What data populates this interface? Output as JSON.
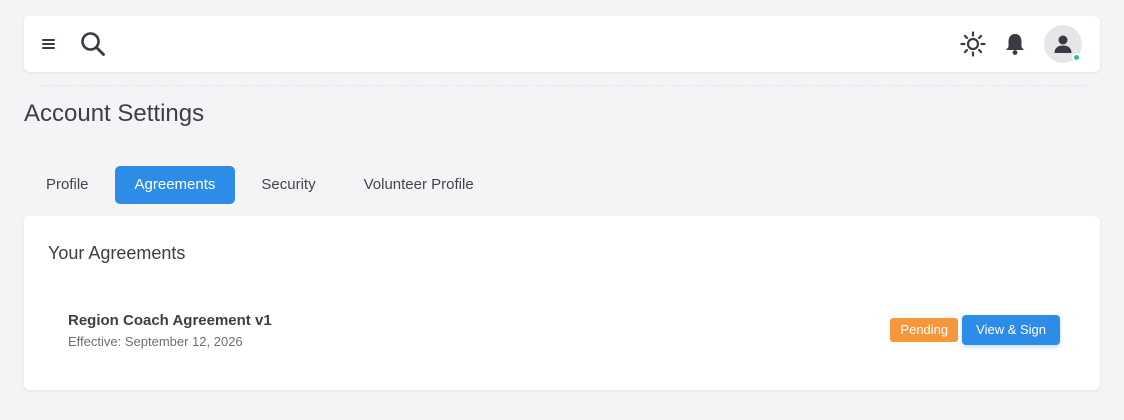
{
  "header": {
    "icons": [
      "menu-icon",
      "search-icon",
      "sun-icon",
      "bell-icon",
      "user-icon"
    ],
    "online_status_color": "#28c76f"
  },
  "page": {
    "title": "Account Settings"
  },
  "tabs": [
    {
      "label": "Profile",
      "active": false
    },
    {
      "label": "Agreements",
      "active": true
    },
    {
      "label": "Security",
      "active": false
    },
    {
      "label": "Volunteer Profile",
      "active": false
    }
  ],
  "agreements_card": {
    "title": "Your Agreements",
    "items": [
      {
        "name": "Region Coach Agreement v1",
        "effective": "Effective: September 12, 2026",
        "status": "Pending",
        "action_label": "View & Sign"
      }
    ]
  },
  "colors": {
    "primary": "#2d8ce8",
    "pending": "#f8963c",
    "background": "#f4f4f7"
  }
}
